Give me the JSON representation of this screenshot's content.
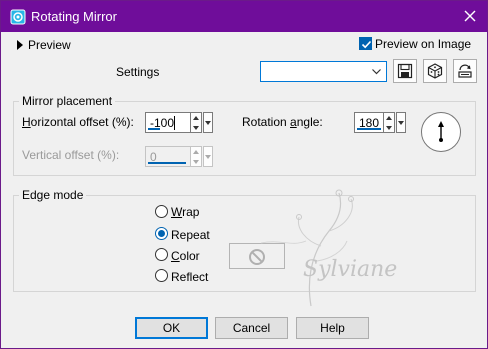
{
  "window": {
    "title": "Rotating Mirror",
    "close_icon": "close-icon",
    "title_icon": "app-icon"
  },
  "preview": {
    "toggle_label": "Preview",
    "preview_on_image_label": "Preview on Image",
    "preview_on_image_checked": true
  },
  "settings": {
    "label": "Settings",
    "selected_value": "",
    "save_icon": "save-icon",
    "randomize_icon": "dice-icon",
    "reset_icon": "reset-icon"
  },
  "mirror_placement": {
    "title": "Mirror placement",
    "horizontal_offset_label_underlined": "H",
    "horizontal_offset_label_rest": "orizontal offset (%):",
    "horizontal_offset_value": "-100",
    "vertical_offset_label": "Vertical offset (%):",
    "vertical_offset_value": "0",
    "vertical_offset_enabled": false,
    "rotation_angle_label_start": "Rotation ",
    "rotation_angle_label_underlined": "a",
    "rotation_angle_label_rest": "ngle:",
    "rotation_angle_value": "180"
  },
  "edge_mode": {
    "title": "Edge mode",
    "options": [
      {
        "label_underlined": "W",
        "label_rest": "rap",
        "selected": false
      },
      {
        "label_underlined": "",
        "label_rest": "Repeat",
        "selected": true
      },
      {
        "label_underlined": "C",
        "label_rest": "olor",
        "selected": false
      },
      {
        "label_underlined": "",
        "label_rest": "Reflect",
        "selected": false
      }
    ],
    "color_swatch_icon": "no-color-icon"
  },
  "watermark_text": "Sylviane",
  "buttons": {
    "ok": "OK",
    "cancel": "Cancel",
    "help": "Help"
  }
}
